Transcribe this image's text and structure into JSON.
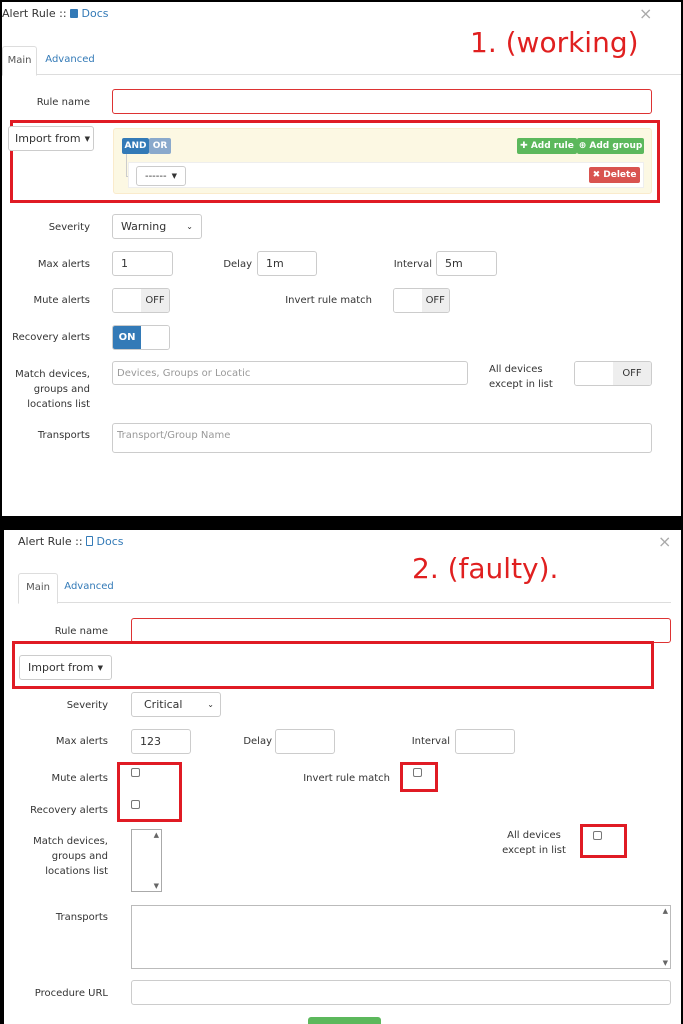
{
  "panel1": {
    "header": {
      "title": "Alert Rule :: ",
      "docs": "Docs",
      "close": "×"
    },
    "annotation": "1. (working)",
    "tabs": {
      "main": "Main",
      "advanced": "Advanced"
    },
    "rule_name_label": "Rule name",
    "import_from": "Import from",
    "builder": {
      "and": "AND",
      "or": "OR",
      "add_rule": "Add rule",
      "add_group": "Add group",
      "select": "------",
      "delete": "Delete"
    },
    "severity_label": "Severity",
    "severity_value": "Warning",
    "max_alerts_label": "Max alerts",
    "max_alerts_value": "1",
    "delay_label": "Delay",
    "delay_value": "1m",
    "interval_label": "Interval",
    "interval_value": "5m",
    "mute_alerts_label": "Mute alerts",
    "mute_alerts_state": "OFF",
    "invert_label": "Invert rule match",
    "invert_state": "OFF",
    "recovery_label": "Recovery alerts",
    "recovery_state": "ON",
    "match_label_1": "Match devices,",
    "match_label_2": "groups and",
    "match_label_3": "locations list",
    "match_placeholder": "Devices, Groups or Locatic",
    "all_devices_label_1": "All devices",
    "all_devices_label_2": "except in list",
    "all_devices_state": "OFF",
    "transports_label": "Transports",
    "transports_placeholder": "Transport/Group Name"
  },
  "panel2": {
    "header": {
      "title": "Alert Rule :: ",
      "docs": "Docs",
      "close": "×"
    },
    "annotation": "2. (faulty).",
    "tabs": {
      "main": "Main",
      "advanced": "Advanced"
    },
    "rule_name_label": "Rule name",
    "import_from": "Import from",
    "severity_label": "Severity",
    "severity_value": "Critical",
    "max_alerts_label": "Max alerts",
    "max_alerts_value": "123",
    "delay_label": "Delay",
    "interval_label": "Interval",
    "mute_alerts_label": "Mute alerts",
    "invert_label": "Invert rule match",
    "recovery_label": "Recovery alerts",
    "match_label_1": "Match devices,",
    "match_label_2": "groups and",
    "match_label_3": "locations list",
    "all_devices_label_1": "All devices",
    "all_devices_label_2": "except in list",
    "transports_label": "Transports",
    "procedure_label": "Procedure URL"
  }
}
